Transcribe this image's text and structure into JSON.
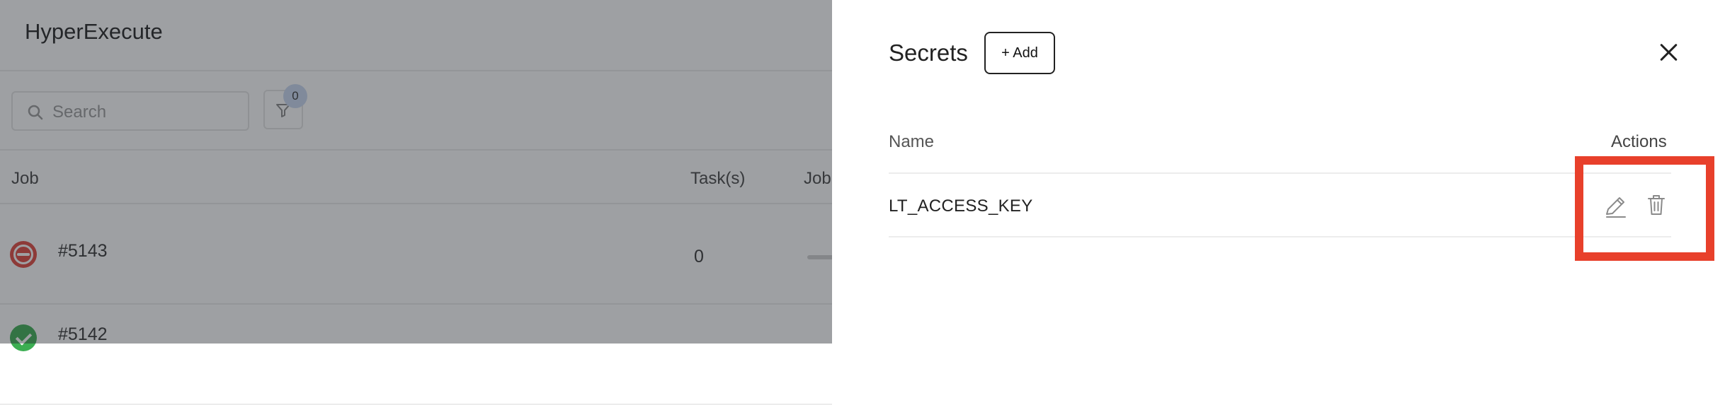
{
  "app": {
    "title": "HyperExecute",
    "search": {
      "placeholder": "Search"
    },
    "filter": {
      "badge_count": "0"
    },
    "table": {
      "headers": {
        "job": "Job",
        "tasks": "Task(s)",
        "job_status": "Job"
      },
      "rows": [
        {
          "status": "failed",
          "id": "#5143",
          "tasks": "0"
        },
        {
          "status": "passed",
          "id": "#5142",
          "tasks": ""
        }
      ]
    }
  },
  "drawer": {
    "title": "Secrets",
    "add_label": "+ Add",
    "columns": {
      "name": "Name",
      "actions": "Actions"
    },
    "secrets": [
      {
        "name": "LT_ACCESS_KEY"
      }
    ],
    "icons": {
      "close": "close-icon",
      "edit": "pencil-icon",
      "delete": "trash-icon"
    }
  },
  "colors": {
    "highlight": "#e8402b",
    "status_failed": "#e0453d",
    "status_passed": "#3cae52"
  }
}
